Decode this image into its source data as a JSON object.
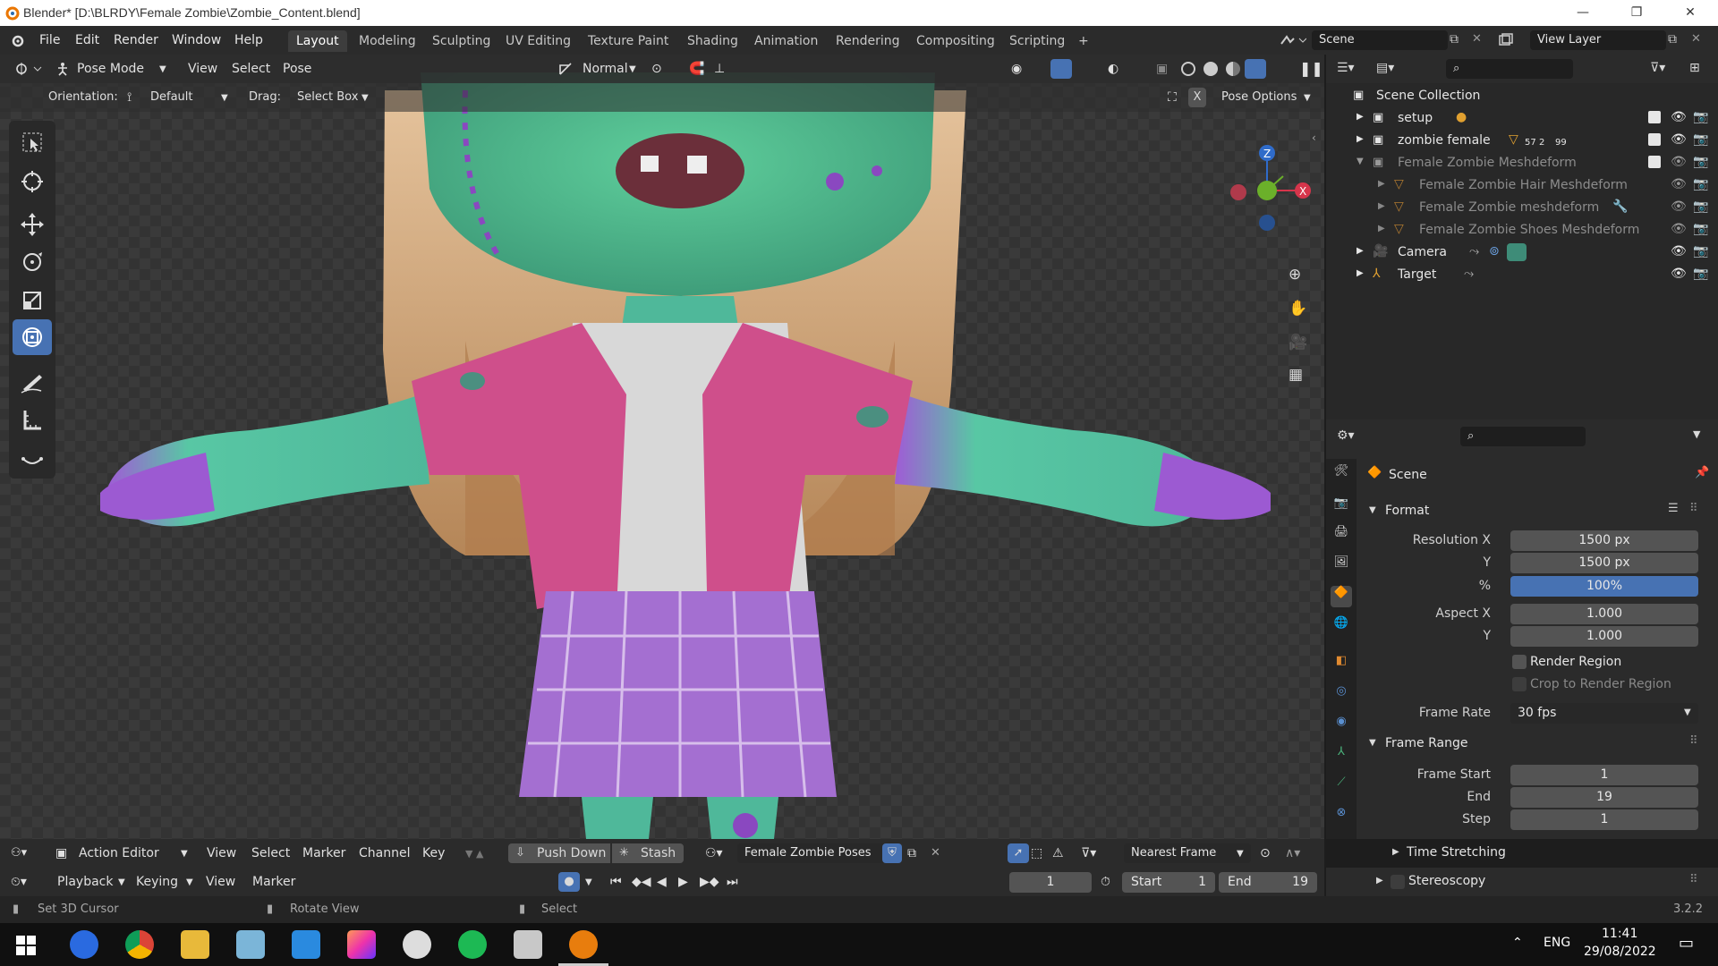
{
  "window": {
    "title": "Blender* [D:\\BLRDY\\Female Zombie\\Zombie_Content.blend]",
    "min": "—",
    "max": "❐",
    "close": "✕"
  },
  "menu": [
    "File",
    "Edit",
    "Render",
    "Window",
    "Help"
  ],
  "workspaces": [
    "Layout",
    "Modeling",
    "Sculpting",
    "UV Editing",
    "Texture Paint",
    "Shading",
    "Animation",
    "Rendering",
    "Compositing",
    "Scripting",
    "+"
  ],
  "scene": "Scene",
  "view_layer": "View Layer",
  "viewport_header": {
    "mode": "Pose Mode",
    "items": [
      "View",
      "Select",
      "Pose"
    ],
    "orientation_glob": "Normal"
  },
  "tool_header": {
    "orientation_label": "Orientation:",
    "orientation": "Default",
    "drag_label": "Drag:",
    "drag": "Select Box",
    "pose_options": "Pose Options",
    "x": "X"
  },
  "outliner": {
    "rows": [
      {
        "label": "Scene Collection"
      },
      {
        "label": "setup"
      },
      {
        "label": "zombie female",
        "badge1": "57",
        "badge2": "2",
        "badge3": "99"
      },
      {
        "label": "Female Zombie Meshdeform"
      },
      {
        "label": "Female Zombie Hair Meshdeform"
      },
      {
        "label": "Female Zombie meshdeform"
      },
      {
        "label": "Female Zombie Shoes Meshdeform"
      },
      {
        "label": "Camera"
      },
      {
        "label": "Target"
      }
    ]
  },
  "properties": {
    "context": "Scene",
    "format": {
      "title": "Format",
      "res_x_label": "Resolution X",
      "res_x": "1500 px",
      "res_y_label": "Y",
      "res_y": "1500 px",
      "pct_label": "%",
      "pct": "100%",
      "aspect_x_label": "Aspect X",
      "aspect_x": "1.000",
      "aspect_y_label": "Y",
      "aspect_y": "1.000",
      "render_region": "Render Region",
      "crop": "Crop to Render Region",
      "fps_label": "Frame Rate",
      "fps": "30 fps"
    },
    "frame_range": {
      "title": "Frame Range",
      "start_label": "Frame Start",
      "start": "1",
      "end_label": "End",
      "end": "19",
      "step_label": "Step",
      "step": "1"
    },
    "time_stretching": "Time Stretching",
    "stereoscopy": "Stereoscopy"
  },
  "action_editor": {
    "mode": "Action Editor",
    "items": [
      "View",
      "Select",
      "Marker",
      "Channel",
      "Key"
    ],
    "push_down": "Push Down",
    "stash": "Stash",
    "action": "Female Zombie Poses",
    "snap": "Nearest Frame"
  },
  "timeline": {
    "playback": "Playback",
    "keying": "Keying",
    "view": "View",
    "marker": "Marker",
    "current": "1",
    "start_label": "Start",
    "start": "1",
    "end_label": "End",
    "end": "19"
  },
  "status": {
    "left": "Set 3D Cursor",
    "mid": "Rotate View",
    "right": "Select",
    "version": "3.2.2"
  },
  "taskbar": {
    "lang": "ENG",
    "time": "11:41",
    "date": "29/08/2022"
  },
  "colors": {
    "accent": "#4772b3",
    "bg": "#2b2b2b"
  }
}
